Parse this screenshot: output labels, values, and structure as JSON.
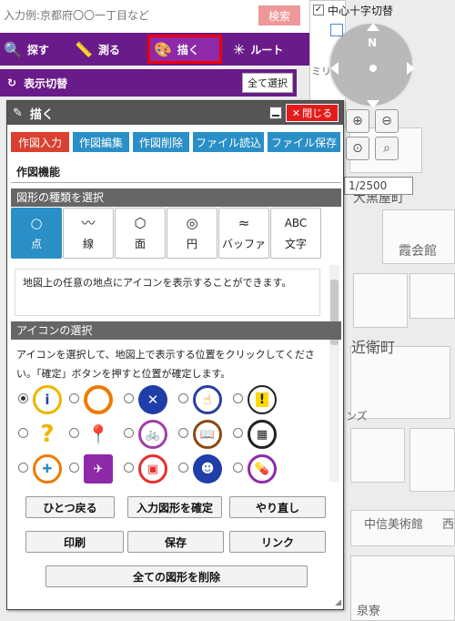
{
  "search": {
    "placeholder": "入力例:京都府〇〇一丁目など",
    "button": "検索"
  },
  "crosshair_label": "中心十字切替",
  "modes": [
    {
      "label": "探す",
      "icon": "search-icon"
    },
    {
      "label": "測る",
      "icon": "ruler-icon"
    },
    {
      "label": "描く",
      "icon": "palette-icon"
    },
    {
      "label": "ルート",
      "icon": "route-icon"
    }
  ],
  "active_mode": "描く",
  "toggle": {
    "label": "表示切替",
    "select_all": "全て選択"
  },
  "scale": "1/2500",
  "map_labels": [
    "中心十字切替",
    "大黒屋町",
    "霞会館",
    "近衛町",
    "ンズ",
    "中信美術館",
    "西",
    "泉寮",
    "ミリ"
  ],
  "panel": {
    "title": "描く",
    "close": "閉じる",
    "tabs": [
      "作図入力",
      "作図編集",
      "作図削除",
      "ファイル読込",
      "ファイル保存"
    ],
    "section_func": "作図機能",
    "section_shape": "図形の種類を選択",
    "shapes": [
      {
        "label": "点",
        "icon": "point-icon",
        "glyph": "○"
      },
      {
        "label": "線",
        "icon": "line-icon",
        "glyph": "〰"
      },
      {
        "label": "面",
        "icon": "polygon-icon",
        "glyph": "⬡"
      },
      {
        "label": "円",
        "icon": "circle-icon",
        "glyph": "◎"
      },
      {
        "label": "バッファ",
        "icon": "buffer-icon",
        "glyph": "≈"
      },
      {
        "label": "文字",
        "icon": "text-icon",
        "glyph": "ABC"
      }
    ],
    "description": "地図上の任意の地点にアイコンを表示することができます。",
    "section_icon": "アイコンの選択",
    "instruction": "アイコンを選択して、地図上で表示する位置をクリックしてください。「確定」ボタンを押すと位置が確定します。",
    "icons": [
      [
        "info-icon",
        "circle-icon",
        "x-icon",
        "hand-icon",
        "warning-icon"
      ],
      [
        "question-icon",
        "pin-icon",
        "bicycle-icon",
        "book-icon",
        "calendar-icon"
      ],
      [
        "hospital-icon",
        "helicopter-icon",
        "building-icon",
        "face-icon",
        "pills-icon"
      ]
    ],
    "buttons": {
      "undo": "ひとつ戻る",
      "confirm": "入力図形を確定",
      "redo": "やり直し",
      "print": "印刷",
      "save": "保存",
      "link": "リンク",
      "delete_all": "全ての図形を削除"
    }
  }
}
